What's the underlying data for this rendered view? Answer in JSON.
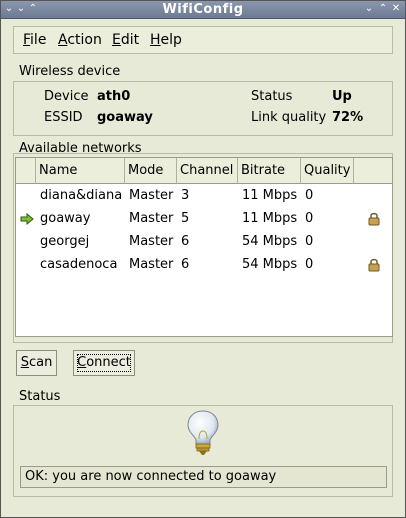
{
  "window": {
    "title": "WifiConfig",
    "left_controls": [
      "⌄",
      "⌄",
      "⌃"
    ],
    "right_controls": [
      "⌄",
      "⌃",
      "✕"
    ]
  },
  "menu": [
    {
      "label": "File",
      "mnemonic": "F",
      "rest": "ile"
    },
    {
      "label": "Action",
      "mnemonic": "A",
      "rest": "ction"
    },
    {
      "label": "Edit",
      "mnemonic": "E",
      "rest": "dit"
    },
    {
      "label": "Help",
      "mnemonic": "H",
      "rest": "elp"
    }
  ],
  "device": {
    "section_label": "Wireless device",
    "device_label": "Device",
    "device_value": "ath0",
    "essid_label": "ESSID",
    "essid_value": "goaway",
    "status_label": "Status",
    "status_value": "Up",
    "quality_label": "Link quality",
    "quality_value": "72%"
  },
  "networks": {
    "section_label": "Available networks",
    "columns": [
      "Name",
      "Mode",
      "Channel",
      "Bitrate",
      "Quality"
    ],
    "rows": [
      {
        "connected": false,
        "name": "diana&diana",
        "mode": "Master",
        "channel": "3",
        "bitrate": "11 Mbps",
        "quality": "0",
        "locked": false
      },
      {
        "connected": true,
        "name": "goaway",
        "mode": "Master",
        "channel": "5",
        "bitrate": "11 Mbps",
        "quality": "0",
        "locked": true
      },
      {
        "connected": false,
        "name": "georgej",
        "mode": "Master",
        "channel": "6",
        "bitrate": "54 Mbps",
        "quality": "0",
        "locked": false
      },
      {
        "connected": false,
        "name": "casadenoca",
        "mode": "Master",
        "channel": "6",
        "bitrate": "54 Mbps",
        "quality": "0",
        "locked": true
      }
    ]
  },
  "buttons": {
    "scan": {
      "mnemonic": "S",
      "rest": "can"
    },
    "connect": {
      "mnemonic": "C",
      "rest": "onnect"
    }
  },
  "status": {
    "section_label": "Status",
    "message": "OK: you are now connected to goaway"
  }
}
